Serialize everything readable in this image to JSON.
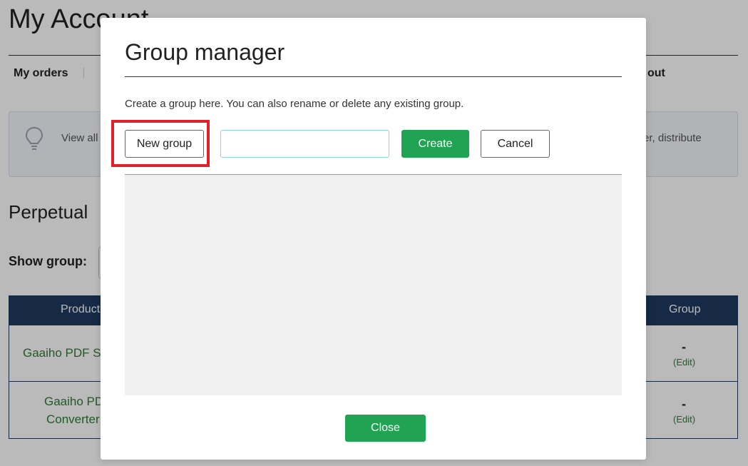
{
  "background": {
    "page_title": "My Account",
    "nav": {
      "orders": "My orders",
      "sign_out": "gn out"
    },
    "info": {
      "left_text": "View all",
      "right_text": "aller, distribute"
    },
    "section_title": "Perpetual",
    "show_group_label": "Show group:",
    "table": {
      "headers": {
        "product": "Product",
        "group": "Group"
      },
      "rows": [
        {
          "product_lines": [
            "Gaaiho PDF S"
          ],
          "group": "-",
          "edit": "(Edit)"
        },
        {
          "product_lines": [
            "Gaaiho PD",
            "Converter"
          ],
          "group": "-",
          "edit": "(Edit)"
        }
      ]
    }
  },
  "modal": {
    "title": "Group manager",
    "description": "Create a group here. You can also rename or delete any existing group.",
    "new_group_label": "New group",
    "group_name_value": "",
    "create_label": "Create",
    "cancel_label": "Cancel",
    "close_label": "Close"
  },
  "colors": {
    "accent_green": "#21a354",
    "table_header": "#1f3a5f",
    "highlight_red": "#e0202a"
  }
}
